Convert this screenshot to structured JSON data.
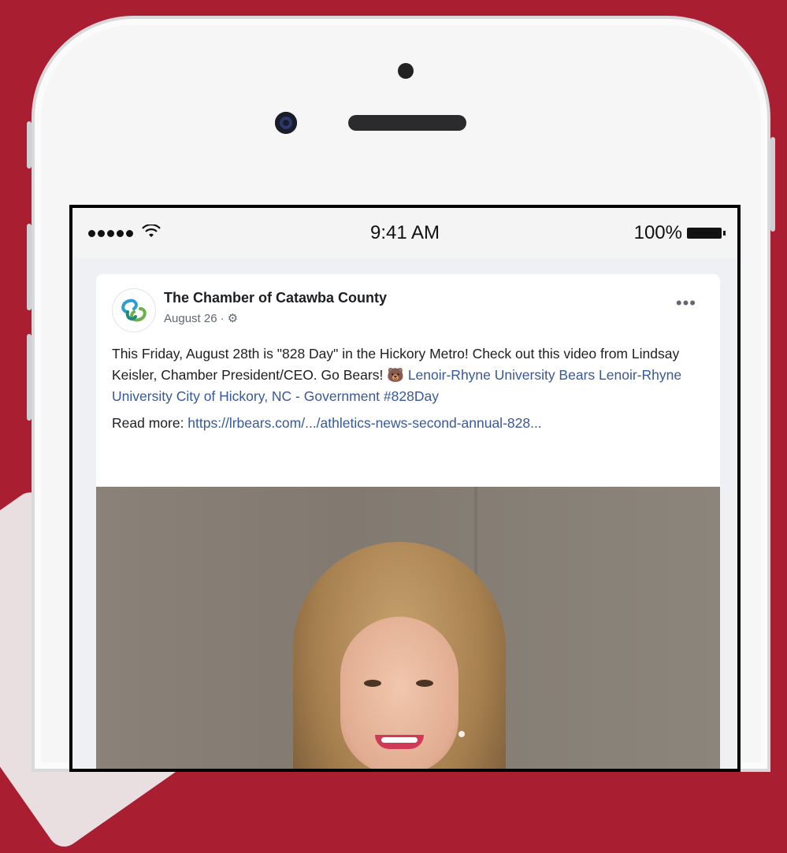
{
  "status_bar": {
    "time": "9:41 AM",
    "battery_percent": "100%",
    "signal_dots": 5
  },
  "post": {
    "page_name": "The Chamber of Catawba County",
    "date": "August 26",
    "meta_separator": "·",
    "more_icon": "•••",
    "text_plain": "This Friday, August 28th is \"828 Day\" in the Hickory Metro! Check out this video from Lindsay Keisler, Chamber President/CEO. Go Bears! 🐻 ",
    "text_link_1": "Lenoir-Rhyne University Bears",
    "text_link_2": "Lenoir-Rhyne University",
    "text_link_3": "City of Hickory, NC - Government",
    "hashtag": "#828Day",
    "read_more_label": "Read more: ",
    "read_more_link": "https://lrbears.com/.../athletics-news-second-annual-828..."
  },
  "icons": {
    "wifi": "wifi-icon",
    "globe": "globe-icon",
    "more": "more-icon",
    "avatar": "chamber-logo-icon"
  },
  "colors": {
    "background": "#a91e30",
    "link": "#385898"
  }
}
